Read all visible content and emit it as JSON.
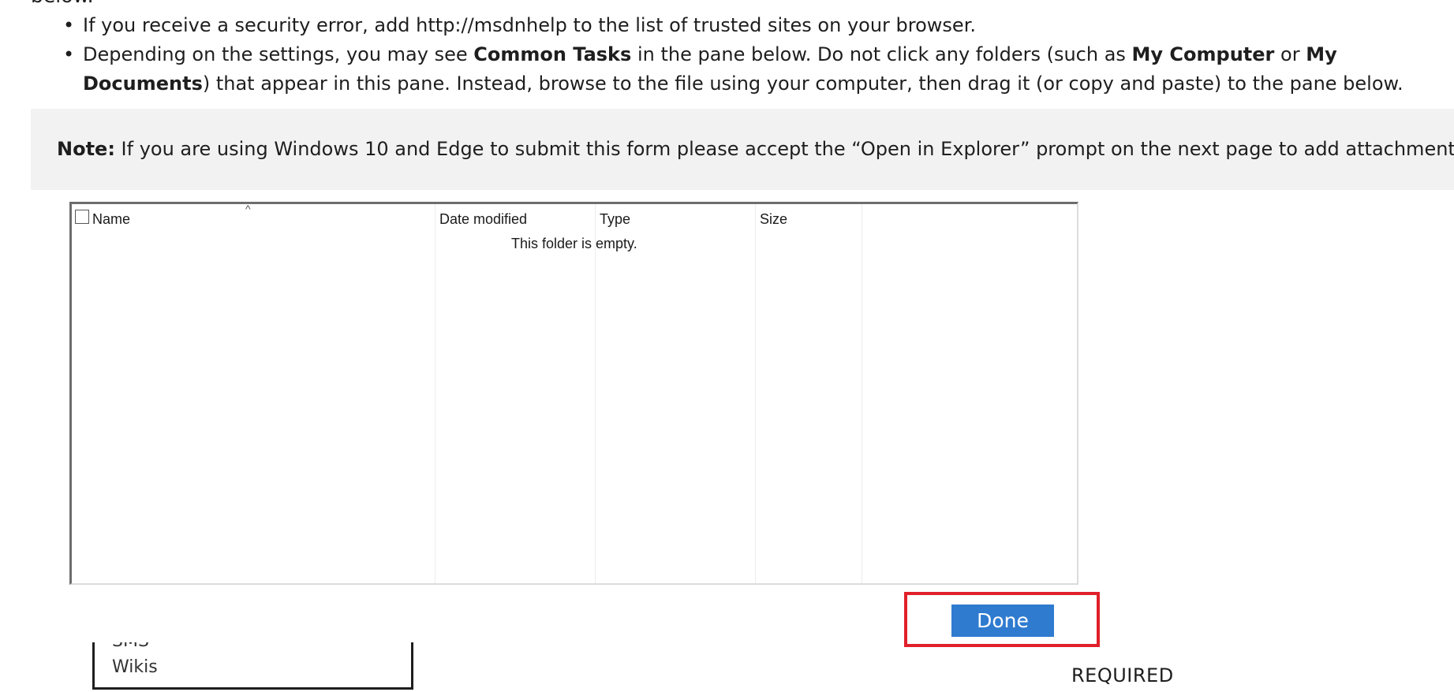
{
  "intro": {
    "cut_off_text": "below."
  },
  "bullets": [
    {
      "text_1": "If you receive a security error, add http://msdnhelp to the list of trusted sites on your browser."
    },
    {
      "text_1": "Depending on the settings, you may see ",
      "bold_1": "Common Tasks",
      "text_2": " in the pane below. Do not click any folders (such as ",
      "bold_2": "My Computer",
      "text_3": " or ",
      "bold_3": "My Documents",
      "text_4": ") that appear in this pane. Instead, browse to the file using your computer, then drag it (or copy and paste) to the pane below."
    }
  ],
  "bullet_glyph": "•",
  "note": {
    "label": "Note:",
    "text": " If you are using Windows 10 and Edge to submit this form please accept the “Open in Explorer” prompt on the next page to add attachments."
  },
  "explorer": {
    "columns": [
      "Name",
      "Date modified",
      "Type",
      "Size"
    ],
    "sort_indicator": "^",
    "empty_message": "This folder is empty."
  },
  "done_button": {
    "label": "Done",
    "bg_color": "#2f7bd0",
    "highlight_color": "#e0202a"
  },
  "list": {
    "items": [
      "SMS",
      "Wikis"
    ]
  },
  "required_label": "REQUIRED"
}
